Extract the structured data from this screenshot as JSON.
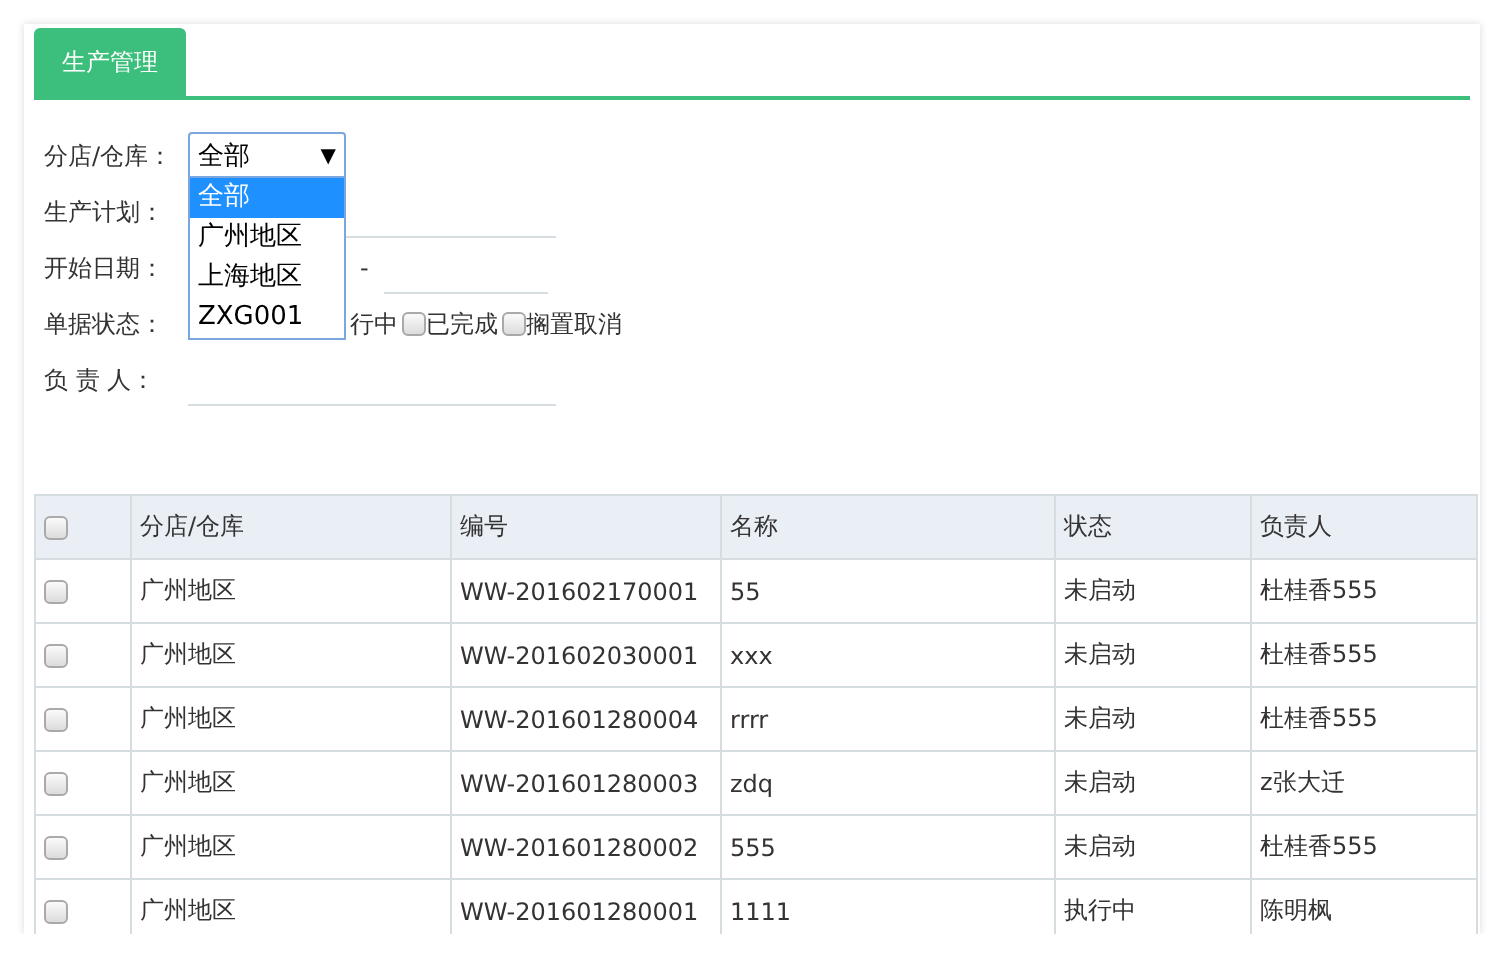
{
  "tabs": [
    {
      "label": "生产管理",
      "selected": true
    }
  ],
  "form": {
    "branch_label": "分店/仓库：",
    "branch_select": {
      "value": "全部",
      "arrow": "▼",
      "options": [
        {
          "label": "全部",
          "selected": true
        },
        {
          "label": "广州地区",
          "selected": false
        },
        {
          "label": "上海地区",
          "selected": false
        },
        {
          "label": "ZXG001",
          "selected": false
        }
      ]
    },
    "plan_label": "生产计划：",
    "date_label": "开始日期：",
    "date_separator": "-",
    "status_label": "单据状态：",
    "status_options": [
      {
        "kind": "text",
        "label": "行中"
      },
      {
        "kind": "checkbox",
        "label": "已完成",
        "checked": false
      },
      {
        "kind": "checkbox",
        "label": "搁置取消",
        "checked": false
      }
    ],
    "person_label": "负 责 人："
  },
  "table": {
    "columns": [
      "分店/仓库",
      "编号",
      "名称",
      "状态",
      "负责人"
    ],
    "header_checked": false,
    "rows": [
      {
        "checked": false,
        "cells": [
          "广州地区",
          "WW-201602170001",
          "55",
          "未启动",
          "杜桂香555"
        ]
      },
      {
        "checked": false,
        "cells": [
          "广州地区",
          "WW-201602030001",
          "xxx",
          "未启动",
          "杜桂香555"
        ]
      },
      {
        "checked": false,
        "cells": [
          "广州地区",
          "WW-201601280004",
          "rrrr",
          "未启动",
          "杜桂香555"
        ]
      },
      {
        "checked": false,
        "cells": [
          "广州地区",
          "WW-201601280003",
          "zdq",
          "未启动",
          "z张大迁"
        ]
      },
      {
        "checked": false,
        "cells": [
          "广州地区",
          "WW-201601280002",
          "555",
          "未启动",
          "杜桂香555"
        ]
      },
      {
        "checked": false,
        "cells": [
          "广州地区",
          "WW-201601280001",
          "1111",
          "执行中",
          "陈明枫"
        ]
      }
    ]
  }
}
